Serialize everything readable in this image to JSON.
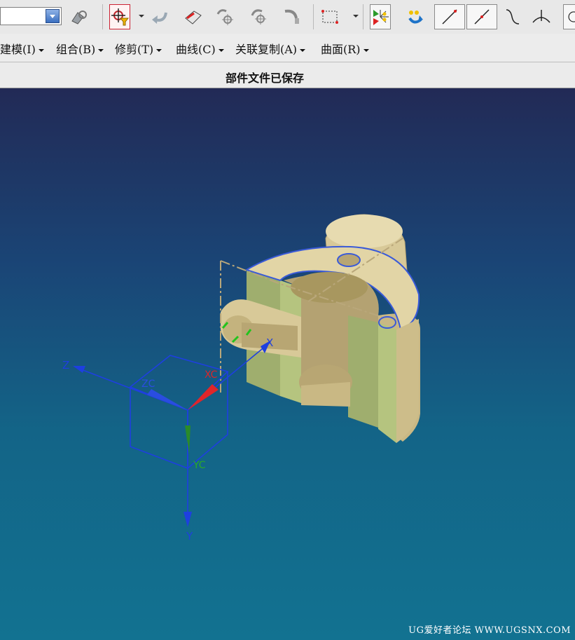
{
  "toolbar": {
    "selection_filter": {
      "value": ""
    },
    "icons": [
      "filter-dropdown-icon",
      "assembly-icon",
      "selection-filter-icon",
      "undo-icon",
      "eraser-icon",
      "snap-point-icon",
      "snap-point-plus-icon",
      "snap-arc-icon",
      "rectangle-select-icon",
      "node-select-icon",
      "node-rotate-icon",
      "line-icon",
      "line-point-icon",
      "curve-icon",
      "normal-icon",
      "circle-icon"
    ]
  },
  "menubar": {
    "items": [
      {
        "label": "建模(I)"
      },
      {
        "label": "组合(B)"
      },
      {
        "label": "修剪(T)"
      },
      {
        "label": "曲线(C)"
      },
      {
        "label": "关联复制(A)"
      },
      {
        "label": "曲面(R)"
      }
    ]
  },
  "status": {
    "message": "部件文件已保存"
  },
  "viewport": {
    "triad_labels": {
      "x": "X",
      "y": "Y",
      "z": "Z",
      "xc": "XC",
      "yc": "YC",
      "zc": "ZC"
    },
    "watermark": "UG爱好者论坛 WWW.UGSNX.COM"
  }
}
